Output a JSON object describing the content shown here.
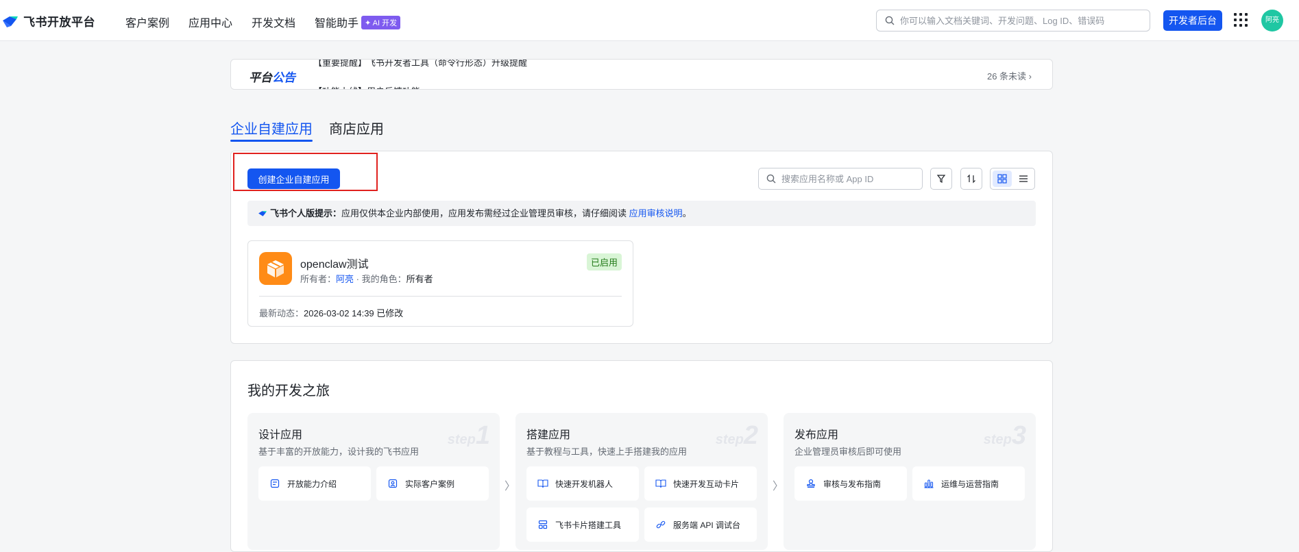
{
  "nav": {
    "logo_text": "飞书开放平台",
    "links": [
      "客户案例",
      "应用中心",
      "开发文档",
      "智能助手"
    ],
    "ai_badge": "✦ AI 开发",
    "search_placeholder": "你可以输入文档关键词、开发问题、Log ID、错误码",
    "dev_console": "开发者后台",
    "avatar_text": "阿亮"
  },
  "announcement": {
    "title_a": "平台",
    "title_b": "公告",
    "line1": "【重要提醒】飞书开发者工具（命令行形态）升级提醒",
    "line2": "【功能上线】用户反馈功能",
    "unread": "26 条未读 ›"
  },
  "tabs": [
    "企业自建应用",
    "商店应用"
  ],
  "apps": {
    "create_button": "创建企业自建应用",
    "search_placeholder": "搜索应用名称或 App ID",
    "tip_label": "飞书个人版提示：",
    "tip_text": "应用仅供本企业内部使用，应用发布需经过企业管理员审核，请仔细阅读 ",
    "tip_link": "应用审核说明",
    "tip_end": "。",
    "card": {
      "name": "openclaw测试",
      "owner_label": "所有者：",
      "owner": "阿亮",
      "sep": " · ",
      "role_label": "我的角色：",
      "role": "所有者",
      "status": "已启用",
      "latest_label": "最新动态：",
      "latest": "2026-03-02 14:39 已修改"
    }
  },
  "journey": {
    "title": "我的开发之旅",
    "step_word": "step",
    "steps": [
      {
        "title": "设计应用",
        "desc": "基于丰富的开放能力，设计我的飞书应用",
        "num": "1",
        "items": [
          "开放能力介绍",
          "实际客户案例"
        ]
      },
      {
        "title": "搭建应用",
        "desc": "基于教程与工具，快速上手搭建我的应用",
        "num": "2",
        "items": [
          "快速开发机器人",
          "快速开发互动卡片",
          "飞书卡片搭建工具",
          "服务端 API 调试台"
        ]
      },
      {
        "title": "发布应用",
        "desc": "企业管理员审核后即可使用",
        "num": "3",
        "items": [
          "审核与发布指南",
          "运维与运营指南"
        ]
      }
    ],
    "arrow": "〉"
  },
  "colors": {
    "primary": "#1456f0",
    "highlight": "#e0211e",
    "app_icon": "#ff8b16",
    "avatar": "#1fc7a3"
  }
}
